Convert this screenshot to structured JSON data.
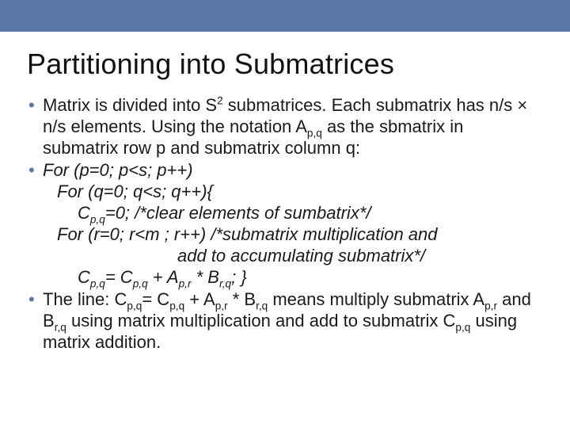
{
  "title": "Partitioning into Submatrices",
  "b1": {
    "p1a": "Matrix is divided into S",
    "p1sup": "2",
    "p1b": " submatrices. Each submatrix has n/s × n/s elements. Using the notation A",
    "p1sub": "p,q",
    "p1c": " as the sbmatrix in submatrix row p and submatrix column q:"
  },
  "b2": {
    "l1": "For (p=0; p<s; p++)",
    "l2": "For (q=0; q<s; q++){",
    "l3a": "C",
    "l3sub": "p,q",
    "l3b": "=0; /*clear elements of sumbatrix*/",
    "l4": "For (r=0; r<m ; r++) /*submatrix multiplication and",
    "l5": "add to accumulating submatrix*/",
    "l6a": "C",
    "l6s1": "p,q",
    "l6b": "= C",
    "l6s2": "p,q",
    "l6c": " + A",
    "l6s3": "p,r",
    "l6d": " * B",
    "l6s4": "r,q",
    "l6e": "; }"
  },
  "b3": {
    "t1": "The line: C",
    "s1": "p,q",
    "t2": "= C",
    "s2": "p,q",
    "t3": " + A",
    "s3": "p,r",
    "t4": " * B",
    "s4": "r,q",
    "t5": " means multiply submatrix A",
    "s5": "p,r",
    "t6": " and B",
    "s6": "r,q",
    "t7": " using matrix multiplication and add to submatrix C",
    "s7": "p,q",
    "t8": " using matrix addition."
  }
}
